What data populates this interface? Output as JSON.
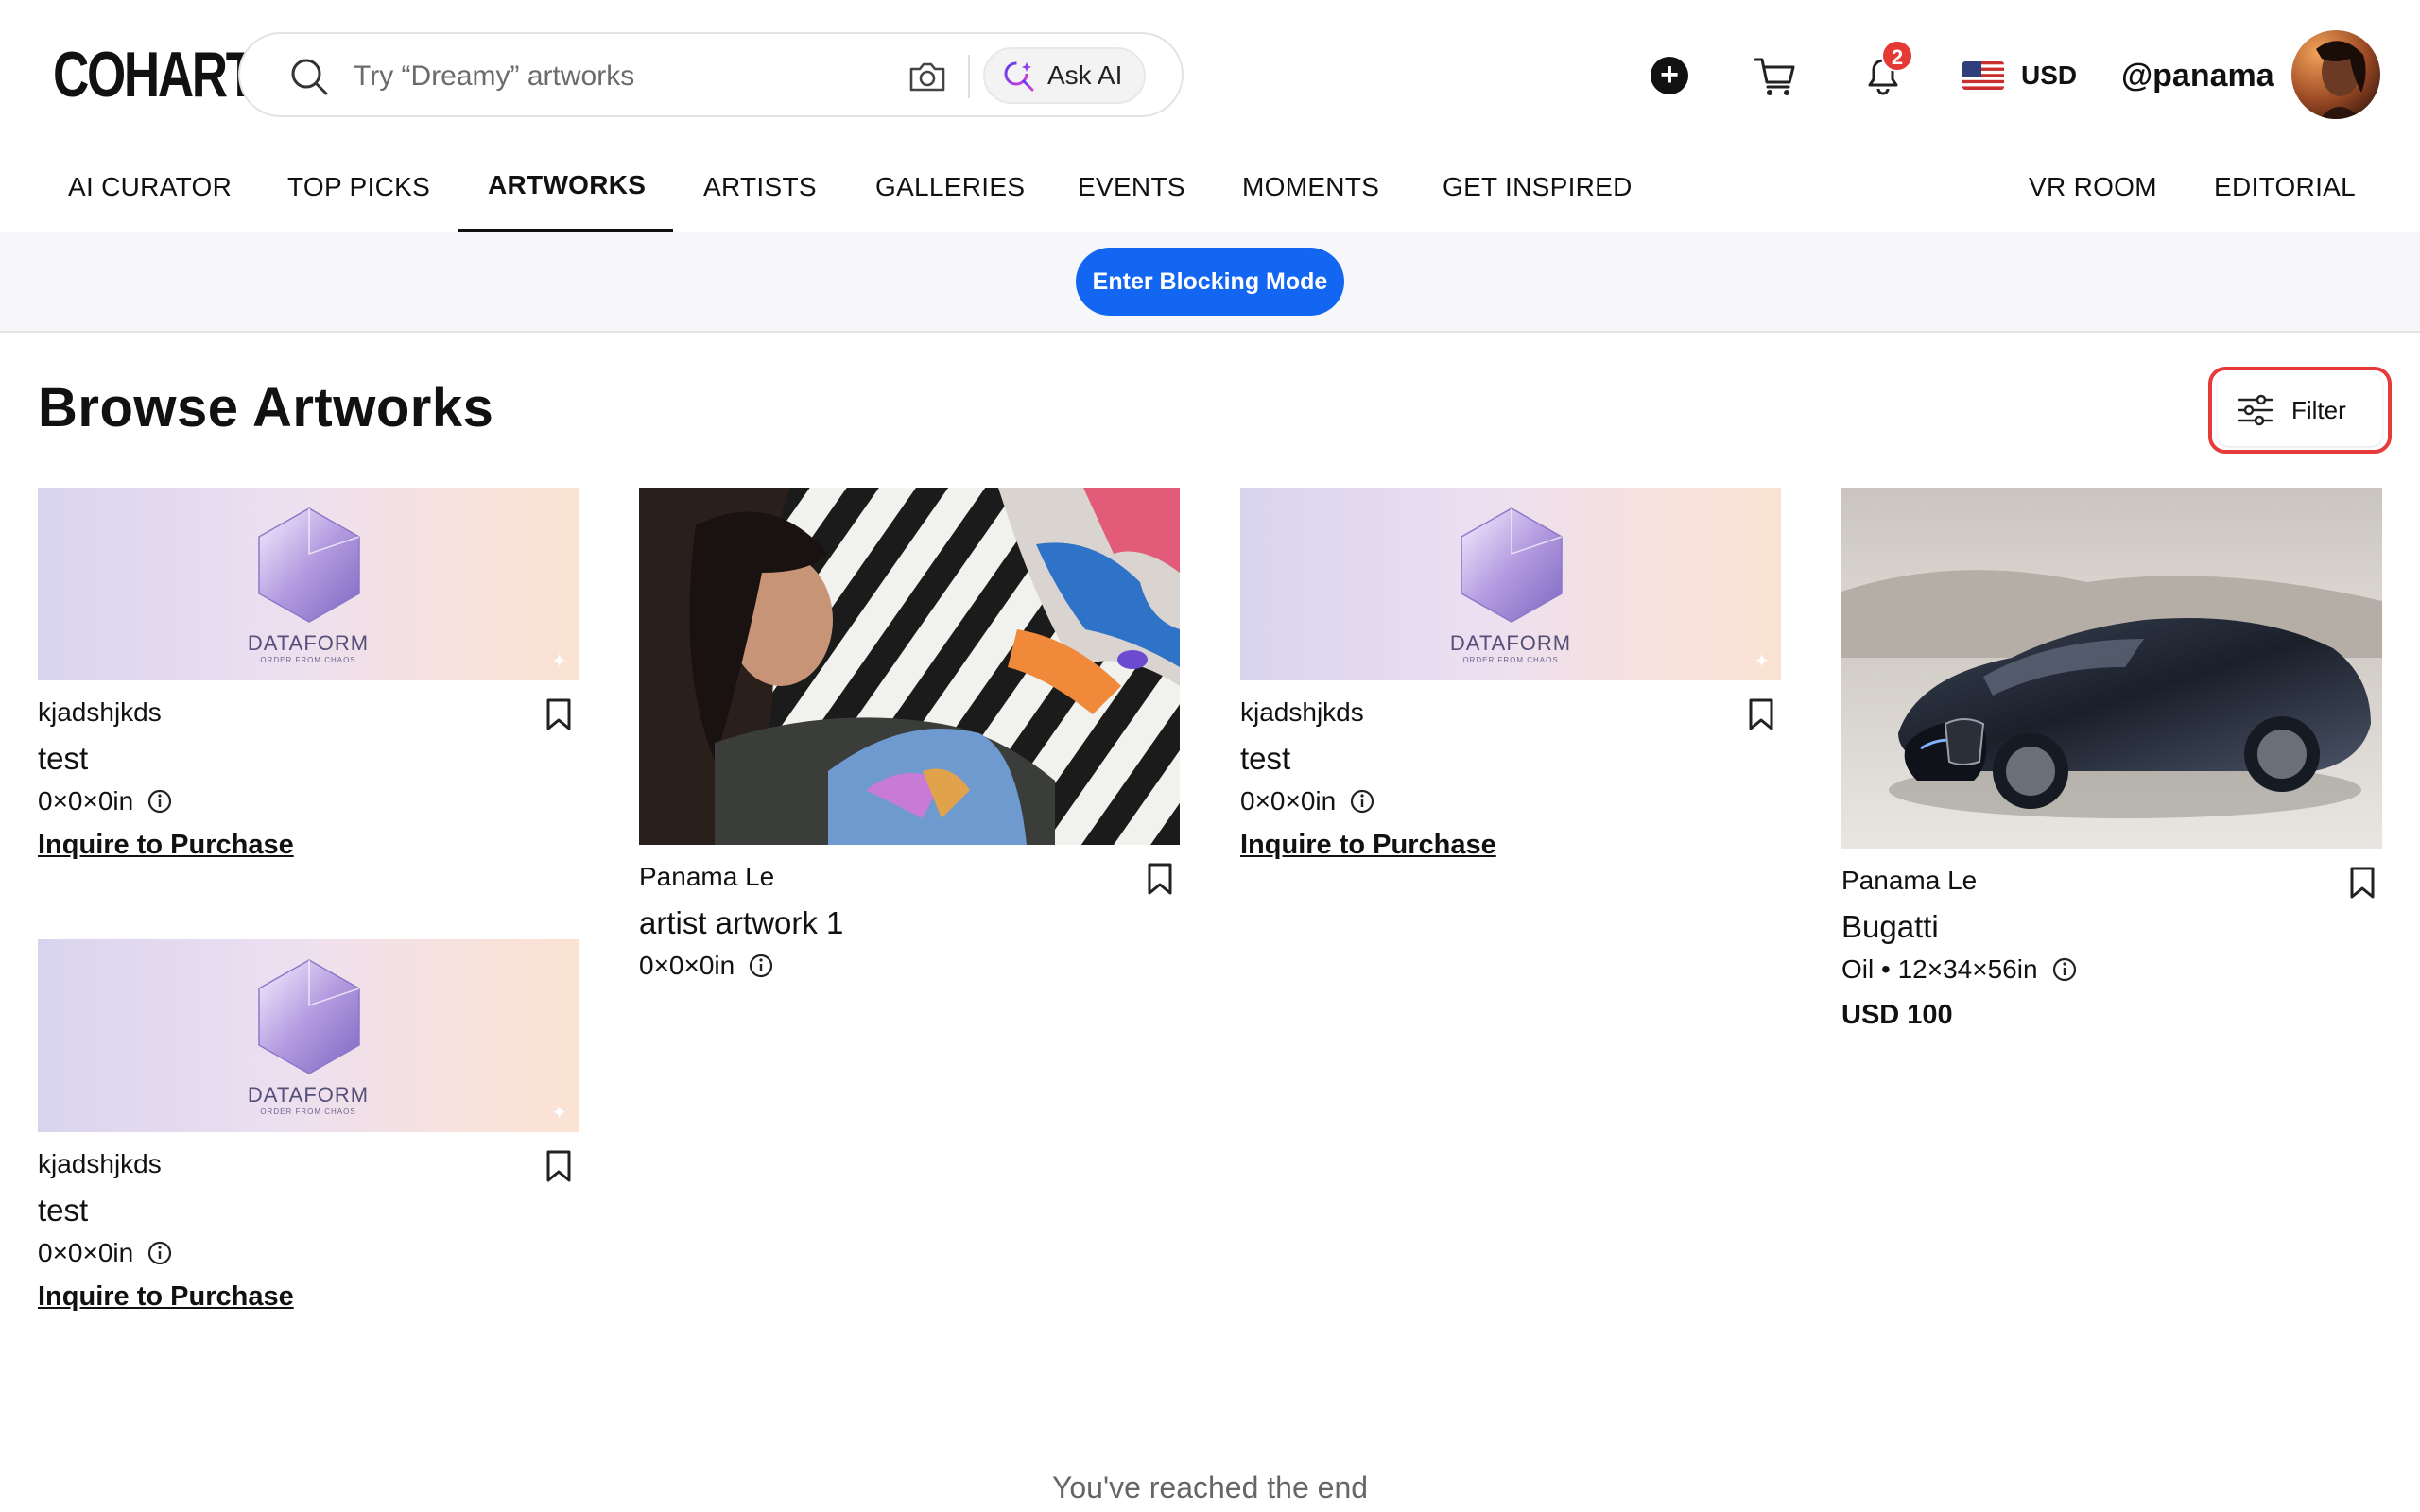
{
  "header": {
    "logo": "COHART",
    "search": {
      "placeholder": "Try “Dreamy” artworks",
      "ask_ai_label": "Ask AI"
    },
    "notifications_count": "2",
    "currency": "USD",
    "username": "@panama"
  },
  "nav": {
    "items": [
      "AI CURATOR",
      "TOP PICKS",
      "ARTWORKS",
      "ARTISTS",
      "GALLERIES",
      "EVENTS",
      "MOMENTS",
      "GET INSPIRED"
    ],
    "right_items": [
      "VR ROOM",
      "EDITORIAL"
    ],
    "active": "ARTWORKS"
  },
  "blocking": {
    "button_label": "Enter Blocking Mode"
  },
  "page": {
    "title": "Browse Artworks",
    "filter_label": "Filter",
    "end_text": "You've reached the end"
  },
  "artworks": [
    {
      "artist": "kjadshjkds",
      "title": "test",
      "dims": "0×0×0in",
      "cta": "Inquire to Purchase",
      "image": "dataform-banner",
      "banner_text": "DATAFORM",
      "banner_sub": "ORDER FROM CHAOS"
    },
    {
      "artist": "Panama Le",
      "title": "artist artwork 1",
      "dims": "0×0×0in",
      "image": "woman-with-rug-photo"
    },
    {
      "artist": "kjadshjkds",
      "title": "test",
      "dims": "0×0×0in",
      "cta": "Inquire to Purchase",
      "image": "dataform-banner",
      "banner_text": "DATAFORM",
      "banner_sub": "ORDER FROM CHAOS"
    },
    {
      "artist": "Panama Le",
      "title": "Bugatti",
      "dims": "Oil • 12×34×56in",
      "price": "USD 100",
      "image": "bugatti-car-photo"
    },
    {
      "artist": "kjadshjkds",
      "title": "test",
      "dims": "0×0×0in",
      "cta": "Inquire to Purchase",
      "image": "dataform-banner",
      "banner_text": "DATAFORM",
      "banner_sub": "ORDER FROM CHAOS"
    }
  ],
  "colors": {
    "accent_blue": "#1366f2",
    "badge_red": "#e53935",
    "filter_outline": "#e63b3b"
  }
}
